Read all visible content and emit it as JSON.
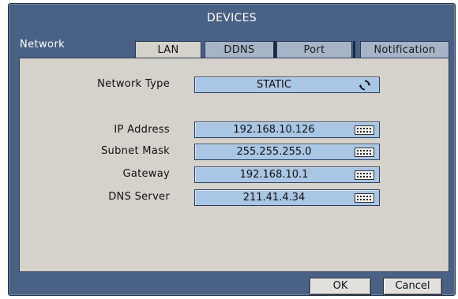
{
  "window": {
    "title": "DEVICES"
  },
  "section": {
    "label": "Network"
  },
  "tabs": [
    {
      "label": "LAN",
      "active": true
    },
    {
      "label": "DDNS",
      "active": false
    },
    {
      "label": "Port",
      "active": false
    },
    {
      "label": "Notification",
      "active": false
    }
  ],
  "network_type": {
    "label": "Network Type",
    "value": "STATIC",
    "icon": "cycle-icon"
  },
  "fields": [
    {
      "label": "IP Address",
      "value": "192.168.10.126",
      "icon": "keyboard-icon"
    },
    {
      "label": "Subnet Mask",
      "value": "255.255.255.0",
      "icon": "keyboard-icon"
    },
    {
      "label": "Gateway",
      "value": "192.168.10.1",
      "icon": "keyboard-icon"
    },
    {
      "label": "DNS Server",
      "value": "211.41.4.34",
      "icon": "keyboard-icon"
    }
  ],
  "buttons": {
    "ok": "OK",
    "cancel": "Cancel"
  },
  "colors": {
    "frame": "#4a6186",
    "panel": "#d5d1cb",
    "field": "#a9c6e4",
    "tab_inactive": "#a7b4c8"
  }
}
